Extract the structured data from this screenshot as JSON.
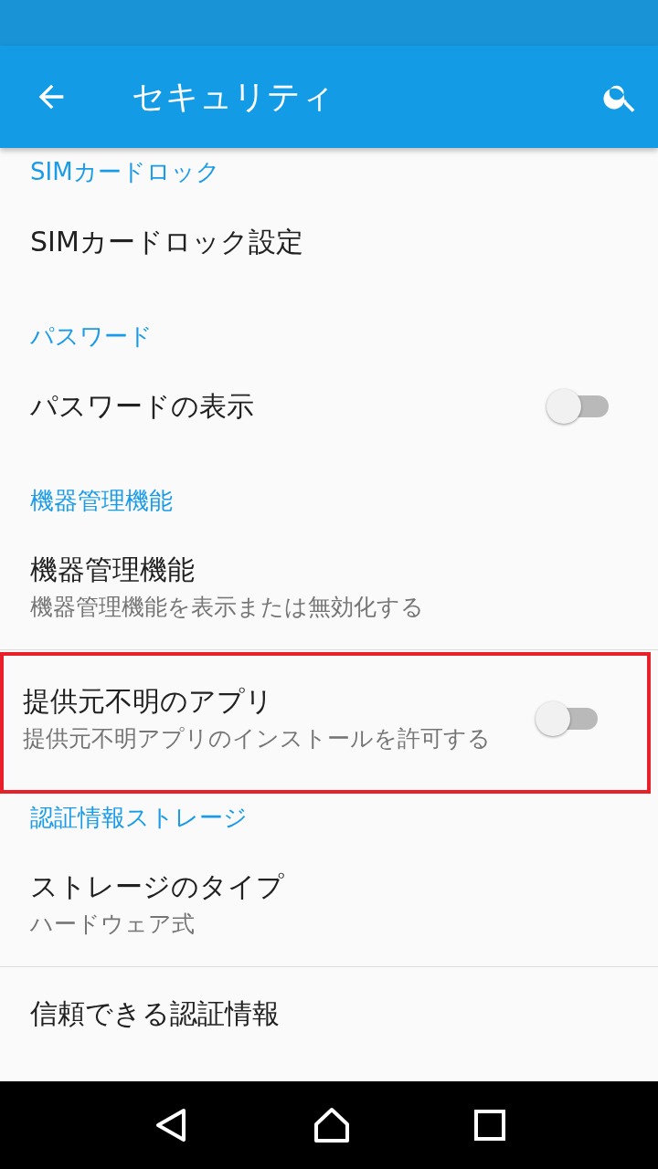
{
  "app_bar": {
    "title": "セキュリティ"
  },
  "sections": [
    {
      "header": "SIMカードロック",
      "items": [
        {
          "kind": "plain",
          "title": "SIMカードロック設定",
          "highlighted": false
        }
      ]
    },
    {
      "header": "パスワード",
      "items": [
        {
          "kind": "switch",
          "title": "パスワードの表示",
          "on": false,
          "highlighted": false
        }
      ]
    },
    {
      "header": "機器管理機能",
      "items": [
        {
          "kind": "plain",
          "title": "機器管理機能",
          "summary": "機器管理機能を表示または無効化する",
          "highlighted": false
        },
        {
          "kind": "switch",
          "title": "提供元不明のアプリ",
          "summary": "提供元不明アプリのインストールを許可する",
          "on": false,
          "highlighted": true
        }
      ]
    },
    {
      "header": "認証情報ストレージ",
      "items": [
        {
          "kind": "plain",
          "title": "ストレージのタイプ",
          "summary": "ハードウェア式",
          "highlighted": false
        },
        {
          "kind": "plain",
          "title": "信頼できる認証情報",
          "highlighted": false
        }
      ]
    }
  ]
}
